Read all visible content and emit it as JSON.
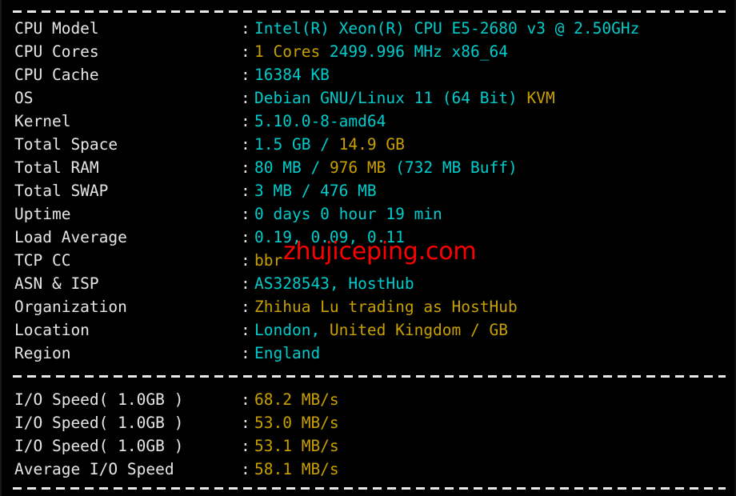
{
  "terminal": {
    "background_color": "#000000",
    "label_color": "#e6e6e6",
    "cyan_color": "#00cccc",
    "yellow_color": "#c8a000",
    "watermark_color": "#ff0000",
    "separator_char": "-",
    "colon": ":"
  },
  "watermark": {
    "text": "zhujiceping.com"
  },
  "sysinfo": {
    "rows": [
      {
        "label": "CPU Model",
        "segments": [
          {
            "text": "Intel(R) Xeon(R) CPU E5-2680 v3 @ 2.50GHz",
            "color": "cyan"
          }
        ]
      },
      {
        "label": "CPU Cores",
        "segments": [
          {
            "text": "1 Cores ",
            "color": "yellow"
          },
          {
            "text": "2499.996 MHz x86_64",
            "color": "cyan"
          }
        ]
      },
      {
        "label": "CPU Cache",
        "segments": [
          {
            "text": "16384 KB",
            "color": "cyan"
          }
        ]
      },
      {
        "label": "OS",
        "segments": [
          {
            "text": "Debian GNU/Linux 11 (64 Bit) ",
            "color": "cyan"
          },
          {
            "text": "KVM",
            "color": "yellow"
          }
        ]
      },
      {
        "label": "Kernel",
        "segments": [
          {
            "text": "5.10.0-8-amd64",
            "color": "cyan"
          }
        ]
      },
      {
        "label": "Total Space",
        "segments": [
          {
            "text": "1.5 GB ",
            "color": "cyan"
          },
          {
            "text": "/ ",
            "color": "cyan"
          },
          {
            "text": "14.9 GB",
            "color": "yellow"
          }
        ]
      },
      {
        "label": "Total RAM",
        "segments": [
          {
            "text": "80 MB ",
            "color": "cyan"
          },
          {
            "text": "/ ",
            "color": "cyan"
          },
          {
            "text": "976 MB ",
            "color": "yellow"
          },
          {
            "text": "(732 MB Buff)",
            "color": "cyan"
          }
        ]
      },
      {
        "label": "Total SWAP",
        "segments": [
          {
            "text": "3 MB / 476 MB",
            "color": "cyan"
          }
        ]
      },
      {
        "label": "Uptime",
        "segments": [
          {
            "text": "0 days 0 hour 19 min",
            "color": "cyan"
          }
        ]
      },
      {
        "label": "Load Average",
        "segments": [
          {
            "text": "0.19, 0.09, 0.11",
            "color": "cyan"
          }
        ]
      },
      {
        "label": "TCP CC",
        "segments": [
          {
            "text": "bbr",
            "color": "yellow"
          }
        ]
      },
      {
        "label": "ASN & ISP",
        "segments": [
          {
            "text": "AS328543, HostHub",
            "color": "cyan"
          }
        ]
      },
      {
        "label": "Organization",
        "segments": [
          {
            "text": "Zhihua Lu trading as HostHub",
            "color": "yellow"
          }
        ]
      },
      {
        "label": "Location",
        "segments": [
          {
            "text": "London, ",
            "color": "cyan"
          },
          {
            "text": "United Kingdom / GB",
            "color": "yellow"
          }
        ]
      },
      {
        "label": "Region",
        "segments": [
          {
            "text": "England",
            "color": "cyan"
          }
        ]
      }
    ]
  },
  "iospeed": {
    "rows": [
      {
        "label": "I/O Speed( 1.0GB )",
        "segments": [
          {
            "text": "68.2 MB/s",
            "color": "yellow"
          }
        ]
      },
      {
        "label": "I/O Speed( 1.0GB )",
        "segments": [
          {
            "text": "53.0 MB/s",
            "color": "yellow"
          }
        ]
      },
      {
        "label": "I/O Speed( 1.0GB )",
        "segments": [
          {
            "text": "53.1 MB/s",
            "color": "yellow"
          }
        ]
      },
      {
        "label": "Average I/O Speed",
        "segments": [
          {
            "text": "58.1 MB/s",
            "color": "yellow"
          }
        ]
      }
    ]
  }
}
